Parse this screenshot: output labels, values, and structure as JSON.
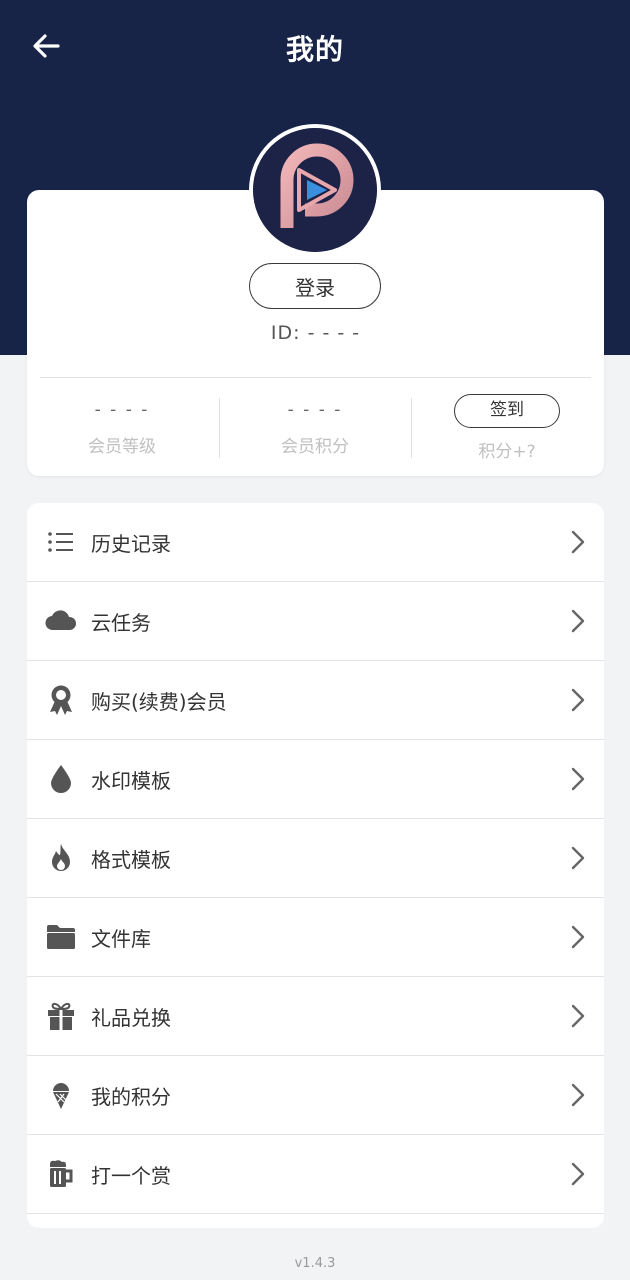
{
  "header": {
    "title": "我的",
    "back_icon": "arrow-left-icon",
    "bg_color": "#172448"
  },
  "profile": {
    "avatar_icon": "app-logo-icon",
    "login_label": "登录",
    "id_text": "ID: - - - -",
    "stats": [
      {
        "value": "- - - -",
        "label": "会员等级"
      },
      {
        "value": "- - - -",
        "label": "会员积分"
      }
    ],
    "signin": {
      "label": "签到",
      "hint": "积分+?"
    }
  },
  "menu": {
    "items": [
      {
        "label": "历史记录",
        "icon": "list-icon"
      },
      {
        "label": "云任务",
        "icon": "cloud-icon"
      },
      {
        "label": "购买(续费)会员",
        "icon": "award-ribbon-icon"
      },
      {
        "label": "水印模板",
        "icon": "water-drop-icon"
      },
      {
        "label": "格式模板",
        "icon": "flame-icon"
      },
      {
        "label": "文件库",
        "icon": "folder-icon"
      },
      {
        "label": "礼品兑换",
        "icon": "gift-icon"
      },
      {
        "label": "我的积分",
        "icon": "ice-cream-icon"
      },
      {
        "label": "打一个赏",
        "icon": "beer-mug-icon"
      }
    ]
  },
  "footer": {
    "version": "v1.4.3"
  }
}
